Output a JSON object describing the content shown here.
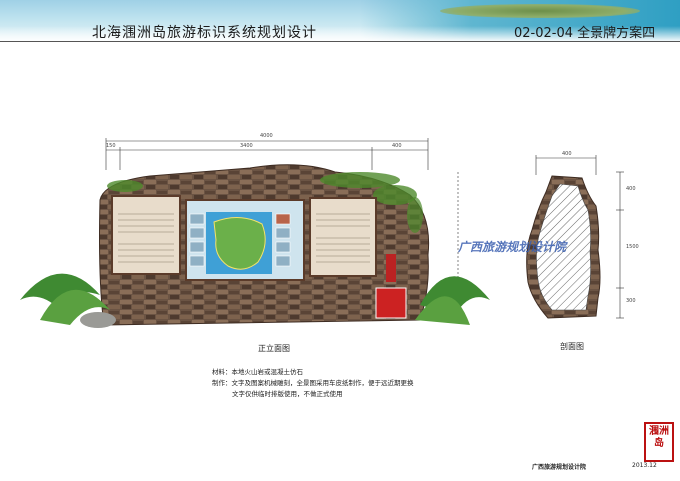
{
  "header": {
    "title": "北海涠洲岛旅游标识系统规划设计",
    "code": "02-02-04 全景牌方案四"
  },
  "dimensions": {
    "total": "4000",
    "left": "150",
    "middle": "3400",
    "right": "400",
    "section_top": "400",
    "height_top": "400",
    "height_mid": "1500",
    "height_bottom": "300"
  },
  "labels": {
    "front": "正立面图",
    "section": "剖面图"
  },
  "notes": {
    "material": "材料：本地火山岩或混凝土仿石",
    "production": "制作：文字及图案机械雕刻，全景图采用车皮纸制作，便于远近期更换",
    "disclaimer": "文字仅供临时排版使用，不做正式使用"
  },
  "watermark": "广西旅游规划设计院",
  "footer": {
    "institute": "广西旅游规划设计院",
    "date": "2013.12"
  },
  "seal": "涠洲岛"
}
